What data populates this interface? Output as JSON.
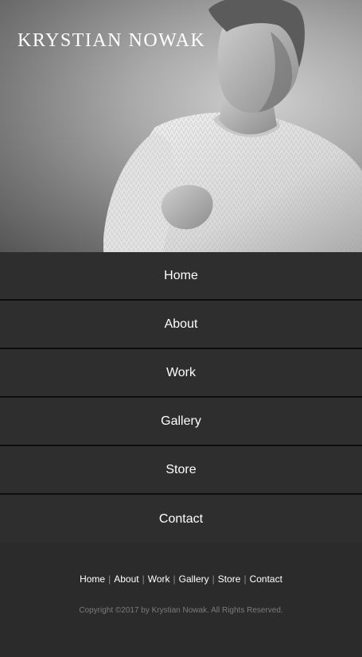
{
  "header": {
    "site_title": "KRYSTIAN NOWAK",
    "hero_image": "portrait-photo"
  },
  "main_nav": {
    "items": [
      {
        "label": "Home"
      },
      {
        "label": "About"
      },
      {
        "label": "Work"
      },
      {
        "label": "Gallery"
      },
      {
        "label": "Store"
      },
      {
        "label": "Contact"
      }
    ]
  },
  "footer": {
    "links": [
      {
        "label": "Home"
      },
      {
        "label": "About"
      },
      {
        "label": "Work"
      },
      {
        "label": "Gallery"
      },
      {
        "label": "Store"
      },
      {
        "label": "Contact"
      }
    ],
    "separator": "|",
    "copyright": "Copyright ©2017 by Krystian Nowak. All Rights Reserved."
  },
  "colors": {
    "background": "#2b2b2b",
    "nav_item_bg": "#2e2e2e",
    "nav_divider": "#0d0d0d",
    "text": "#ffffff",
    "muted_text": "#7b7b7b"
  }
}
